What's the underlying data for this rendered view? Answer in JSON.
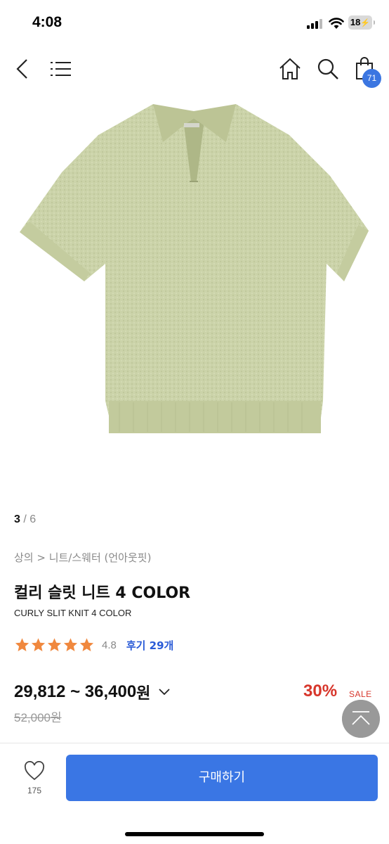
{
  "status_bar": {
    "time": "4:08",
    "battery": "18"
  },
  "nav": {
    "back_icon": "chevron-left-icon",
    "menu_icon": "hamburger-icon",
    "home_icon": "home-icon",
    "search_icon": "search-icon",
    "cart_icon": "shopping-bag-icon",
    "cart_count": "71"
  },
  "gallery": {
    "current": "3",
    "separator": "/",
    "total": "6",
    "image_alt": "product photo"
  },
  "product": {
    "breadcrumb": "상의 > 니트/스웨터 (언아웃핏)",
    "title": "컬리 슬릿 니트 4 COLOR",
    "subtitle": "CURLY SLIT KNIT 4 COLOR",
    "rating_stars": 5,
    "rating": "4.8",
    "reviews": "후기 29개",
    "price_range": "29,812 ~ 36,400",
    "currency": "원",
    "original_price": "52,000원",
    "discount": "30%",
    "sale_label": "SALE"
  },
  "bottom": {
    "wish_count": "175",
    "buy_label": "구매하기"
  },
  "colors": {
    "accent": "#3a76e4",
    "badge": "#3b76e1",
    "discount": "#d7362b",
    "star": "#f0883e",
    "garment": "#c9d2a7"
  }
}
